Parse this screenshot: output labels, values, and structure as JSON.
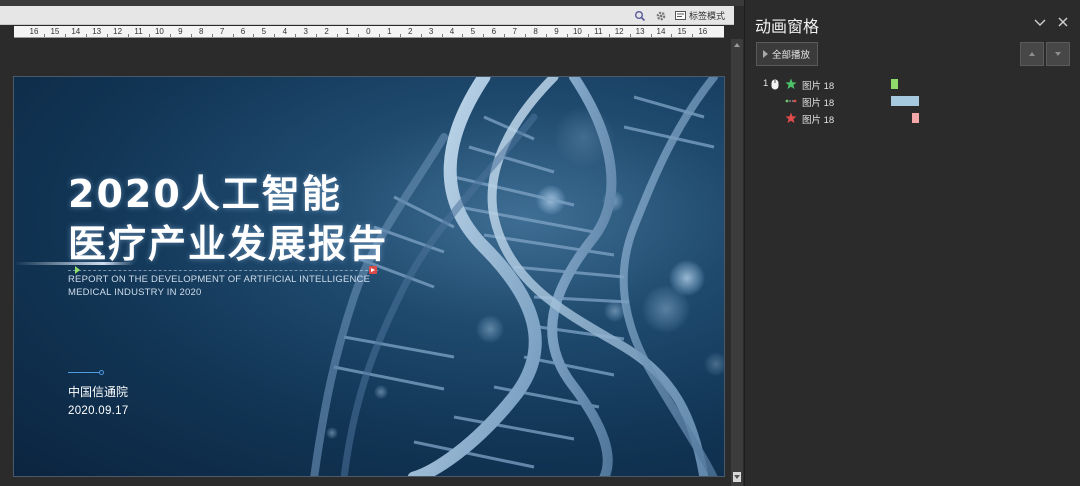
{
  "toolbar": {
    "mode_label": "标签模式",
    "ruler_numbers": [
      "16",
      "15",
      "14",
      "13",
      "12",
      "11",
      "10",
      "9",
      "8",
      "7",
      "6",
      "5",
      "4",
      "3",
      "2",
      "1",
      "0",
      "1",
      "2",
      "3",
      "4",
      "5",
      "6",
      "7",
      "8",
      "9",
      "10",
      "11",
      "12",
      "13",
      "14",
      "15",
      "16"
    ]
  },
  "slide": {
    "title_line1": "2020人工智能",
    "title_line2": "医疗产业发展报告",
    "subtitle_line1": "REPORT ON THE DEVELOPMENT OF ARTIFICIAL INTELLIGENCE",
    "subtitle_line2": "MEDICAL INDUSTRY IN 2020",
    "organization": "中国信通院",
    "date": "2020.09.17"
  },
  "animation_pane": {
    "title": "动画窗格",
    "play_all_label": "全部播放",
    "items": [
      {
        "number": "1",
        "trigger": "mouse-icon",
        "effect": "green-star-icon",
        "label": "图片 18",
        "bar_color": "#8fdc6a"
      },
      {
        "number": "",
        "trigger": "",
        "effect": "motion-path-icon",
        "label": "图片 18",
        "bar_color": "#a7c9df"
      },
      {
        "number": "",
        "trigger": "",
        "effect": "red-star-icon",
        "label": "图片 18",
        "bar_color": "#f4a7a7"
      }
    ]
  },
  "colors": {
    "pane_bg": "#2b2b2b",
    "slide_bg": "#123656",
    "accent_blue": "#4f9be0"
  }
}
